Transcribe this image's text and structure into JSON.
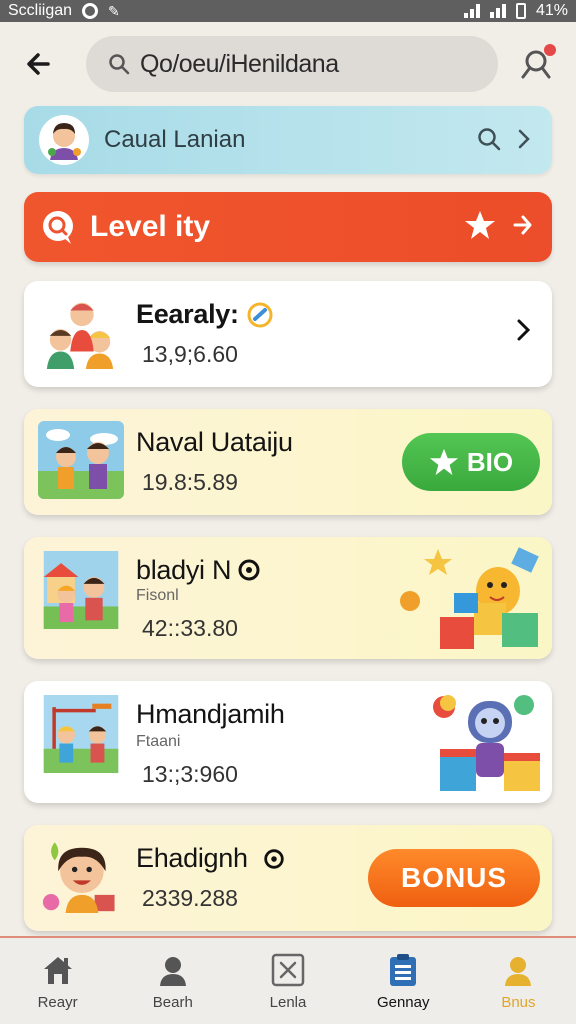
{
  "status_bar": {
    "app_label": "Sccliigan",
    "battery": "41%"
  },
  "header": {
    "search_text": "Qo/oeu/iHenildana"
  },
  "profile": {
    "name": "Caual Lanian"
  },
  "level_bar": {
    "label": "Level ity"
  },
  "cards": [
    {
      "title": "Eearaly:",
      "subtitle": "",
      "value": "13,9;6.60",
      "action": "chevron"
    },
    {
      "title": "Naval Uataiju",
      "subtitle": "",
      "value": "19.8:5.89",
      "action_label": "BIO"
    },
    {
      "title": "bladyi N",
      "subtitle": "Fisonl",
      "value": "42::33.80"
    },
    {
      "title": "Hmandjamih",
      "subtitle": "Ftaani",
      "value": "13:;3:960"
    },
    {
      "title": "Ehadignh",
      "subtitle": "",
      "value": "2339.288",
      "action_label": "BONUS"
    }
  ],
  "bottom_nav": [
    {
      "label": "Reayr",
      "icon": "home-icon"
    },
    {
      "label": "Bearh",
      "icon": "person-icon"
    },
    {
      "label": "Lenla",
      "icon": "close-box-icon"
    },
    {
      "label": "Gennay",
      "icon": "clipboard-icon"
    },
    {
      "label": "Bnus",
      "icon": "user-gold-icon"
    }
  ],
  "colors": {
    "level_bar": "#ef5430",
    "profile_bar": "#b3e1ea",
    "bio_button": "#43b84a",
    "bonus_button": "#f26b1c",
    "nav_active": "#2f6fb5",
    "nav_bonus": "#e0a62a"
  }
}
